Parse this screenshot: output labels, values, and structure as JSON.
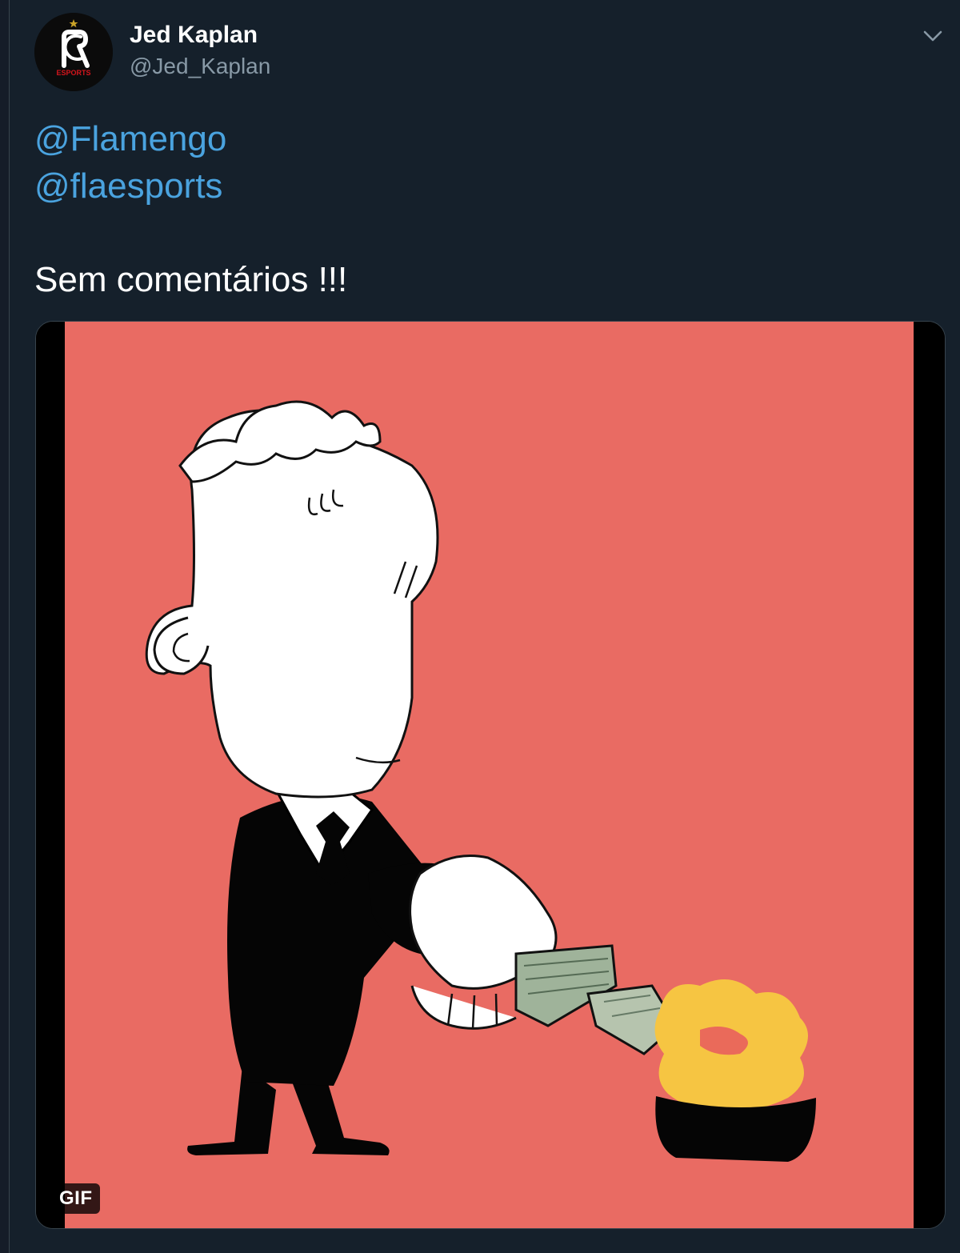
{
  "author": {
    "name": "Jed Kaplan",
    "handle": "@Jed_Kaplan",
    "avatar_logo_text": "ESPORTS",
    "avatar_colors": {
      "background": "#0b0b0b",
      "monogram": "#ffffff",
      "accent": "#d4151c",
      "star": "#c9a227"
    }
  },
  "tweet": {
    "mentions": [
      "@Flamengo",
      "@flaesports"
    ],
    "text": "Sem comentários !!!"
  },
  "media": {
    "badge": "GIF",
    "background_color": "#e96b63",
    "illustration": "cartoon man in suit feeding banknotes into a tray of fire"
  },
  "icons": {
    "menu": "chevron-down-icon"
  },
  "colors": {
    "page_background": "#15202b",
    "link": "#4aa3df",
    "secondary_text": "#8899a6",
    "border": "#38444d"
  }
}
